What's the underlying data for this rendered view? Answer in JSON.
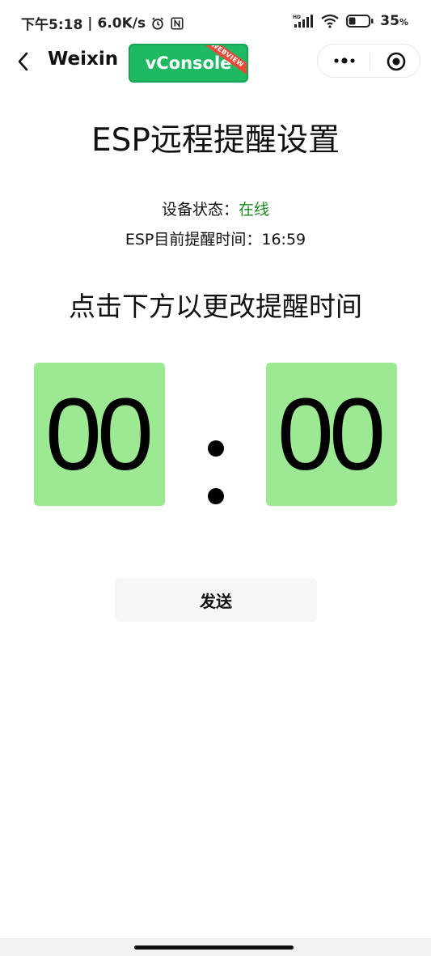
{
  "status_bar": {
    "time": "下午5:18",
    "separator": "|",
    "network_speed": "6.0K/s",
    "battery_percent": "35",
    "battery_percent_sign": "%",
    "battery_level": 0.35,
    "left_icons": [
      "alarm-icon",
      "nfc-icon"
    ],
    "right_icons": [
      "hd-signal-icon",
      "wifi-icon",
      "battery-icon"
    ]
  },
  "nav": {
    "back_icon": "chevron-left-icon",
    "title": "Weixin",
    "vconsole_label": "vConsole",
    "vconsole_ribbon": "WEBVIEW",
    "more_icon": "more-dots-icon",
    "close_icon": "target-close-icon"
  },
  "main": {
    "title": "ESP远程提醒设置",
    "status_label": "设备状态：",
    "status_value": "在线",
    "current_time_label": "ESP目前提醒时间：",
    "current_time_value": "16:59",
    "instruction": "点击下方以更改提醒时间",
    "hour": "00",
    "minute": "00",
    "send_label": "发送"
  },
  "colors": {
    "time_box_bg": "#9de893",
    "online_text": "#1a8a20",
    "vconsole_green": "#1fb964",
    "ribbon_red": "#e84a3a"
  }
}
